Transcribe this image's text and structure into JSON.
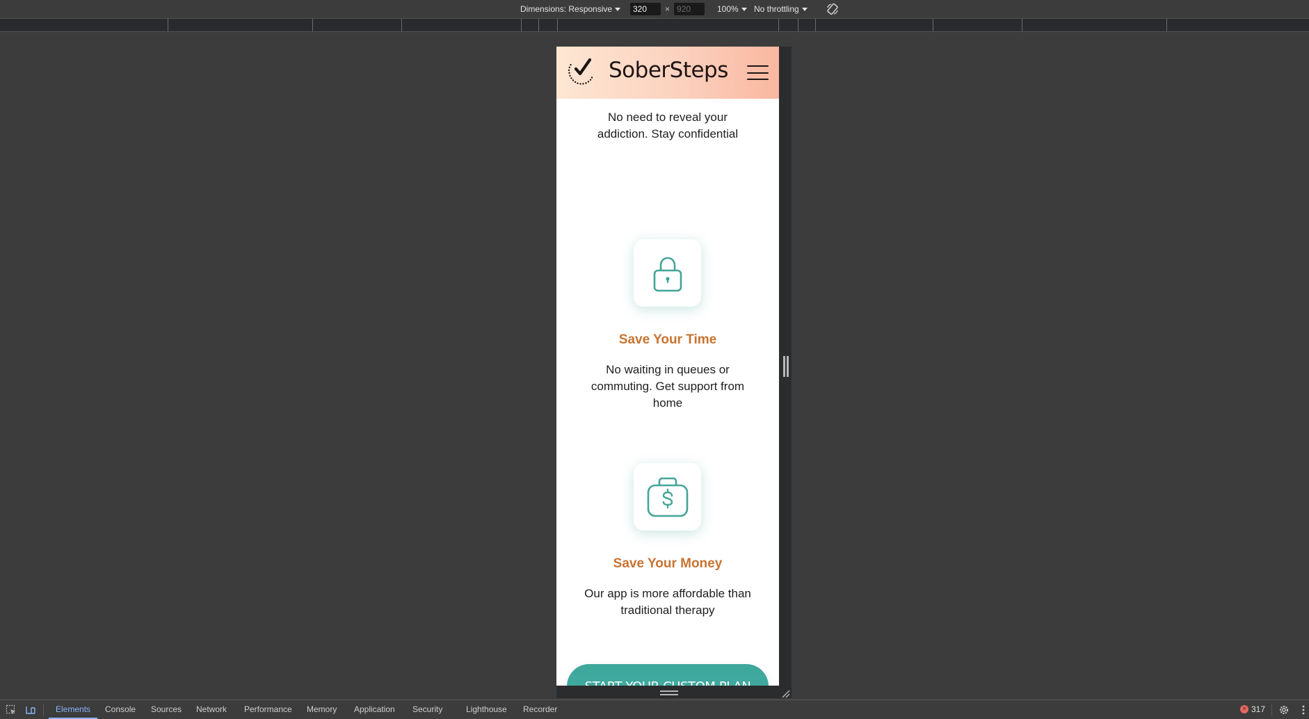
{
  "devtools": {
    "device_toolbar": {
      "dimensions_label": "Dimensions: Responsive",
      "width_value": "320",
      "height_placeholder": "920",
      "times_sign": "×",
      "zoom_label": "100%",
      "throttling_label": "No throttling",
      "rotate_icon": "rotate-icon"
    },
    "tabs": [
      {
        "label": "Elements",
        "active": true
      },
      {
        "label": "Console"
      },
      {
        "label": "Sources"
      },
      {
        "label": "Network"
      },
      {
        "label": "Performance"
      },
      {
        "label": "Memory"
      },
      {
        "label": "Application"
      },
      {
        "label": "Security"
      },
      {
        "label": "Lighthouse"
      },
      {
        "label": "Recorder"
      }
    ],
    "error_count": "317",
    "icons": [
      "inspect-element-icon",
      "device-toggle-icon",
      "settings-gear-icon",
      "more-menu-icon"
    ]
  },
  "site": {
    "brand": "SoberSteps",
    "colors": {
      "accent_teal": "#44aba2",
      "title_orange": "#c87330",
      "header_gradient_start": "#fde7d3",
      "header_gradient_end": "#f9b7a0"
    },
    "intro_desc": "No need to reveal your addiction. Stay confidential",
    "features": [
      {
        "icon": "padlock-icon",
        "title": "Save Your Time",
        "desc": "No waiting in queues or commuting. Get support from home"
      },
      {
        "icon": "money-bag-icon",
        "title": "Save Your Money",
        "desc": "Our app is more affordable than traditional therapy"
      }
    ],
    "cta_label": "START YOUR CUSTOM PLAN"
  }
}
